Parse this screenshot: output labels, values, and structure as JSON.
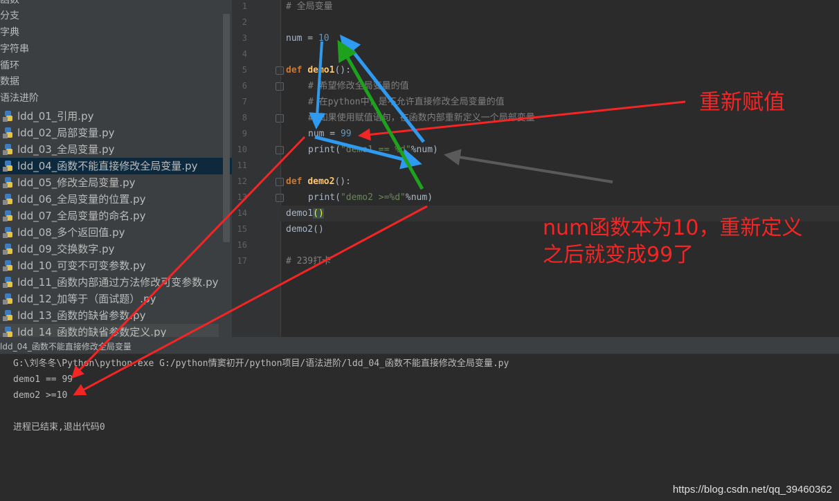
{
  "sidebar": {
    "folders": [
      "函数",
      "分支",
      "字典",
      "字符串",
      "循环",
      "数据",
      "语法进阶"
    ],
    "files": [
      "ldd_01_引用.py",
      "ldd_02_局部变量.py",
      "ldd_03_全局变量.py",
      "ldd_04_函数不能直接修改全局变量.py",
      "ldd_05_修改全局变量.py",
      "ldd_06_全局变量的位置.py",
      "ldd_07_全局变量的命名.py",
      "ldd_08_多个返回值.py",
      "ldd_09_交换数字.py",
      "ldd_10_可变不可变参数.py",
      "ldd_11_函数内部通过方法修改可变参数.py",
      "ldd_12_加等于（面试题）.py",
      "ldd_13_函数的缺省参数.py",
      "ldd_14_函数的缺省参数定义.py"
    ],
    "selected_index": 3
  },
  "editor": {
    "line_numbers": [
      "1",
      "2",
      "3",
      "4",
      "5",
      "6",
      "7",
      "8",
      "9",
      "10",
      "11",
      "12",
      "13",
      "14",
      "15",
      "16",
      "17"
    ],
    "line1": "# 全局变量",
    "line3_name": "num = ",
    "line3_value": "10",
    "line5_kw": "def ",
    "line5_fn": "demo1",
    "line5_rest": "():",
    "line6": "# 希望修改全局变量的值",
    "line7": "# 在python中，是不允许直接修改全局变量的值",
    "line8": "# 如果使用赋值语句，在函数内部重新定义一个局部变量",
    "line9_name": "num = ",
    "line9_value": "99",
    "line10_pre": "print(",
    "line10_str": "\"demo1 == %d\"",
    "line10_post": "%num)",
    "line12_kw": "def ",
    "line12_fn": "demo2",
    "line12_rest": "():",
    "line13_pre": "print(",
    "line13_str": "\"demo2 >=%d\"",
    "line13_post": "%num)",
    "line14_name": "demo1",
    "line14_paren": "()",
    "line15": "demo2()",
    "line17": "# 239打卡"
  },
  "run": {
    "tab_title": "ldd_04_函数不能直接修改全局变量",
    "output": [
      "G:\\刘冬冬\\Python\\python.exe G:/python情窦初开/python项目/语法进阶/ldd_04_函数不能直接修改全局变量.py",
      "demo1 == 99",
      "demo2 >=10",
      "",
      "进程已结束,退出代码0"
    ]
  },
  "annotations": {
    "reassign": "重新赋值",
    "explain_line1": "num函数本为10，重新定义",
    "explain_line2": "之后就变成99了"
  },
  "watermark": "https://blog.csdn.net/qq_39460362",
  "colors": {
    "annotation_red": "#f42525",
    "arrow_blue": "#2f9bf0",
    "arrow_green": "#1ea21e",
    "arrow_gray": "#5a5a5a",
    "selection_bg": "#0d293e"
  }
}
